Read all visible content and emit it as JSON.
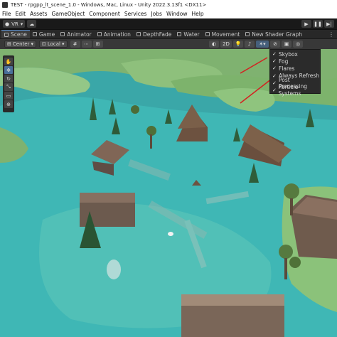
{
  "window": {
    "title": "TEST - rpgpp_lt_scene_1.0 - Windows, Mac, Linux - Unity 2022.3.13f1 <DX11>"
  },
  "menu": [
    "File",
    "Edit",
    "Assets",
    "GameObject",
    "Component",
    "Services",
    "Jobs",
    "Window",
    "Help"
  ],
  "toolbar": {
    "account_label": "VR"
  },
  "tabs": [
    {
      "label": "Scene",
      "active": true
    },
    {
      "label": "Game"
    },
    {
      "label": "Animator"
    },
    {
      "label": "Animation"
    },
    {
      "label": "DepthFade"
    },
    {
      "label": "Water"
    },
    {
      "label": "Movement"
    },
    {
      "label": "New Shader Graph"
    }
  ],
  "scene_toolbar": {
    "pivot_label": "Center",
    "space_label": "Local",
    "mode_2d_label": "2D"
  },
  "effects_menu": {
    "items": [
      {
        "label": "Skybox",
        "checked": true
      },
      {
        "label": "Fog",
        "checked": true
      },
      {
        "label": "Flares",
        "checked": true
      },
      {
        "label": "Always Refresh",
        "checked": true
      },
      {
        "label": "Post Processing",
        "checked": true
      },
      {
        "label": "Particle Systems",
        "checked": true
      }
    ]
  },
  "colors": {
    "water": "#3ab2b0",
    "land": "#8bc27a",
    "arrow": "#d42020"
  }
}
